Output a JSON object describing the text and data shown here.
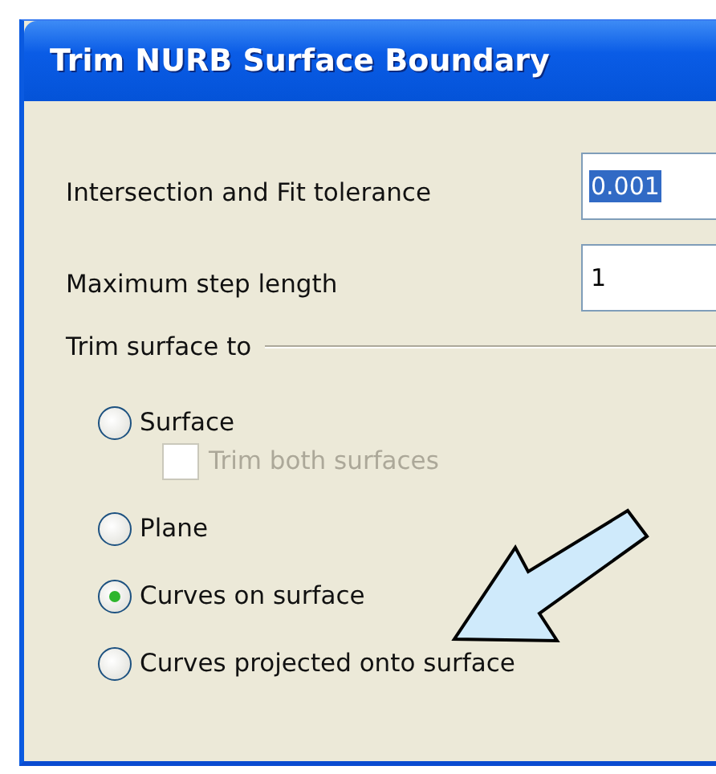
{
  "window": {
    "title": "Trim NURB Surface Boundary"
  },
  "fields": [
    {
      "label": "Intersection and Fit tolerance",
      "value": "0.001",
      "text_selected": true
    },
    {
      "label": "Maximum step length",
      "value": "1",
      "text_selected": false
    }
  ],
  "group": {
    "label": "Trim surface to",
    "options": [
      {
        "kind": "radio",
        "label": "Surface",
        "selected": false,
        "children": [
          {
            "kind": "checkbox",
            "label": "Trim both surfaces",
            "checked": false,
            "disabled": true
          }
        ]
      },
      {
        "kind": "radio",
        "label": "Plane",
        "selected": false
      },
      {
        "kind": "radio",
        "label": "Curves on surface",
        "selected": true
      },
      {
        "kind": "radio",
        "label": "Curves projected onto surface",
        "selected": false
      }
    ]
  }
}
